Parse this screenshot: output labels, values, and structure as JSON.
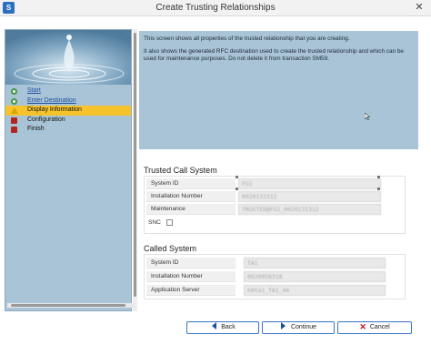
{
  "window": {
    "title": "Create Trusting Relationships"
  },
  "steps": [
    {
      "label": "Start",
      "status": "done",
      "icon": "green-circle-icon"
    },
    {
      "label": "Enter Destination",
      "status": "done",
      "icon": "green-circle-icon"
    },
    {
      "label": "Display Information",
      "status": "current",
      "icon": "warning-triangle-icon"
    },
    {
      "label": "Configuration",
      "status": "pending",
      "icon": "red-square-icon"
    },
    {
      "label": "Finish",
      "status": "pending",
      "icon": "red-square-icon"
    }
  ],
  "info": {
    "para1": "This screen shows all properties of the trusted relationship that you are creating.",
    "para2": "It also shows the generated RFC destination used to create the trusted relationship and which can be used for maintenance purposes. Do not delete it from transaction SM59."
  },
  "trusted_call_system": {
    "title": "Trusted Call System",
    "fields": [
      {
        "label": "System ID",
        "value": "FG1"
      },
      {
        "label": "Installation Number",
        "value": "0020131312"
      },
      {
        "label": "Maintenance",
        "value": "TRUSTED@FG1_0020131312"
      }
    ],
    "snc_label": "SNC"
  },
  "called_system": {
    "title": "Called System",
    "fields": [
      {
        "label": "System ID",
        "value": "TA1"
      },
      {
        "label": "Installation Number",
        "value": "0020058318"
      },
      {
        "label": "Application Server",
        "value": "h0ta1_TA1_46"
      }
    ]
  },
  "buttons": {
    "back": "Back",
    "continue": "Continue",
    "cancel": "Cancel"
  },
  "colors": {
    "panel": "#a8c4d6",
    "accent": "#3b72c4",
    "current_step": "#f6c32c"
  }
}
